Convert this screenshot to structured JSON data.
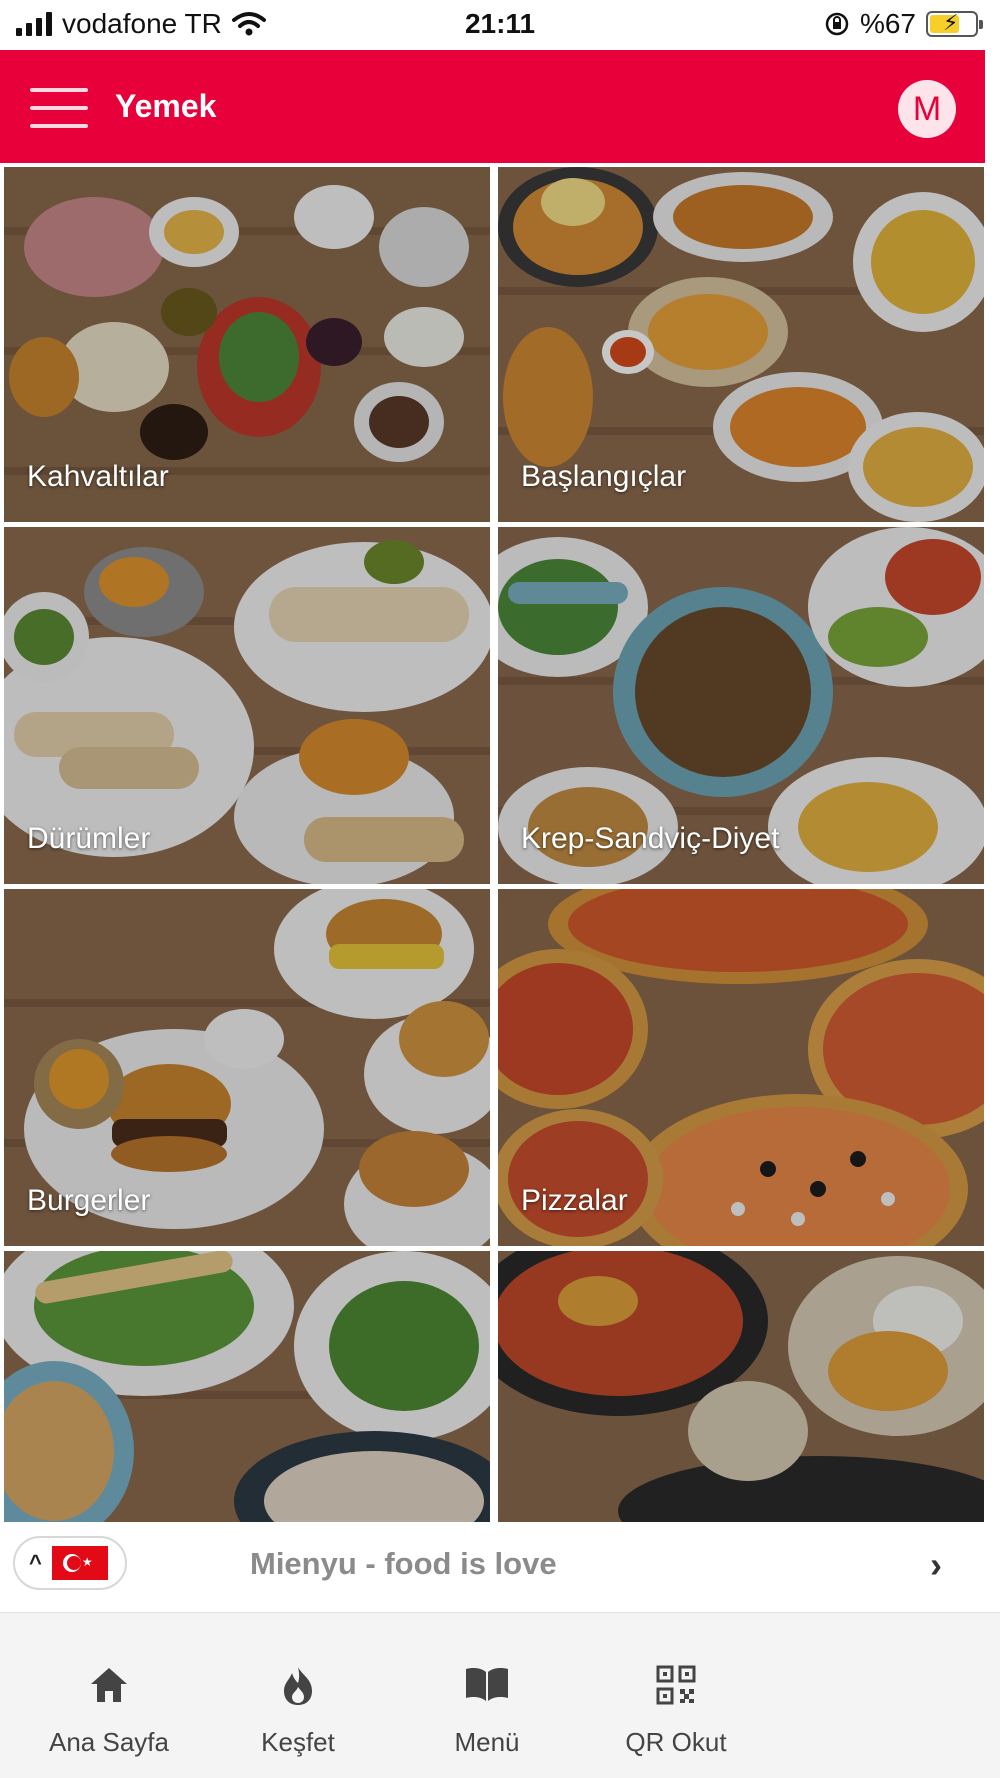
{
  "status_bar": {
    "carrier": "vodafone TR",
    "time": "21:11",
    "battery": "%67",
    "battery_level": 0.67
  },
  "header": {
    "title": "Yemek",
    "avatar_letter": "M",
    "accent_color": "#e8003a"
  },
  "categories": [
    {
      "label": "Kahvaltılar"
    },
    {
      "label": "Başlangıçlar"
    },
    {
      "label": "Dürümler"
    },
    {
      "label": "Krep-Sandviç-Diyet"
    },
    {
      "label": "Burgerler"
    },
    {
      "label": "Pizzalar"
    },
    {
      "label": ""
    },
    {
      "label": ""
    }
  ],
  "footer": {
    "brand_text": "Mienyu - food is love",
    "language_flag": "turkey-flag-icon"
  },
  "bottom_nav": {
    "items": [
      {
        "label": "Ana Sayfa",
        "icon": "home-icon"
      },
      {
        "label": "Keşfet",
        "icon": "fire-icon"
      },
      {
        "label": "Menü",
        "icon": "book-icon"
      },
      {
        "label": "QR Okut",
        "icon": "qr-code-icon"
      }
    ]
  }
}
